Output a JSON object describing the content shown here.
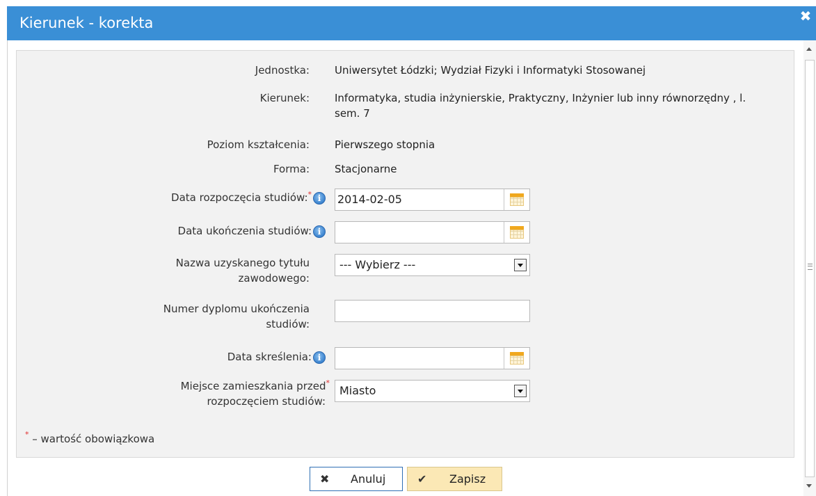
{
  "dialog": {
    "title": "Kierunek - korekta",
    "close_glyph": "✖"
  },
  "fields": {
    "jednostka": {
      "label": "Jednostka:",
      "value": "Uniwersytet Łódzki; Wydział Fizyki i Informatyki Stosowanej"
    },
    "kierunek": {
      "label": "Kierunek:",
      "value_line1": "Informatyka, studia inżynierskie, Praktyczny, Inżynier lub inny równorzędny , l.",
      "value_line2": "sem. 7"
    },
    "poziom": {
      "label": "Poziom kształcenia:",
      "value": "Pierwszego stopnia"
    },
    "forma": {
      "label": "Forma:",
      "value": "Stacjonarne"
    },
    "data_rozpoczecia": {
      "label": "Data rozpoczęcia studiów:",
      "value": "2014-02-05",
      "required": true
    },
    "data_ukonczenia": {
      "label": "Data ukończenia studiów:",
      "value": ""
    },
    "tytul": {
      "label_line1": "Nazwa uzyskanego tytułu",
      "label_line2": "zawodowego:",
      "selected": "--- Wybierz ---"
    },
    "dyplom": {
      "label_line1": "Numer dyplomu ukończenia",
      "label_line2": "studiów:",
      "value": ""
    },
    "data_skreslenia": {
      "label": "Data skreślenia:",
      "value": ""
    },
    "miejsce": {
      "label_line1": "Miejsce zamieszkania przed",
      "label_line2": "rozpoczęciem studiów:",
      "selected": "Miasto",
      "required": true
    }
  },
  "footnote": {
    "star": "*",
    "text": " – wartość obowiązkowa"
  },
  "buttons": {
    "cancel": {
      "label": "Anuluj",
      "icon": "✖"
    },
    "save": {
      "label": "Zapisz",
      "icon": "✔"
    }
  },
  "icons": {
    "info_glyph": "i",
    "required_star": "*"
  },
  "colors": {
    "titlebar": "#3a8fd6",
    "save_button": "#fbe8b5",
    "required": "#e03030"
  }
}
